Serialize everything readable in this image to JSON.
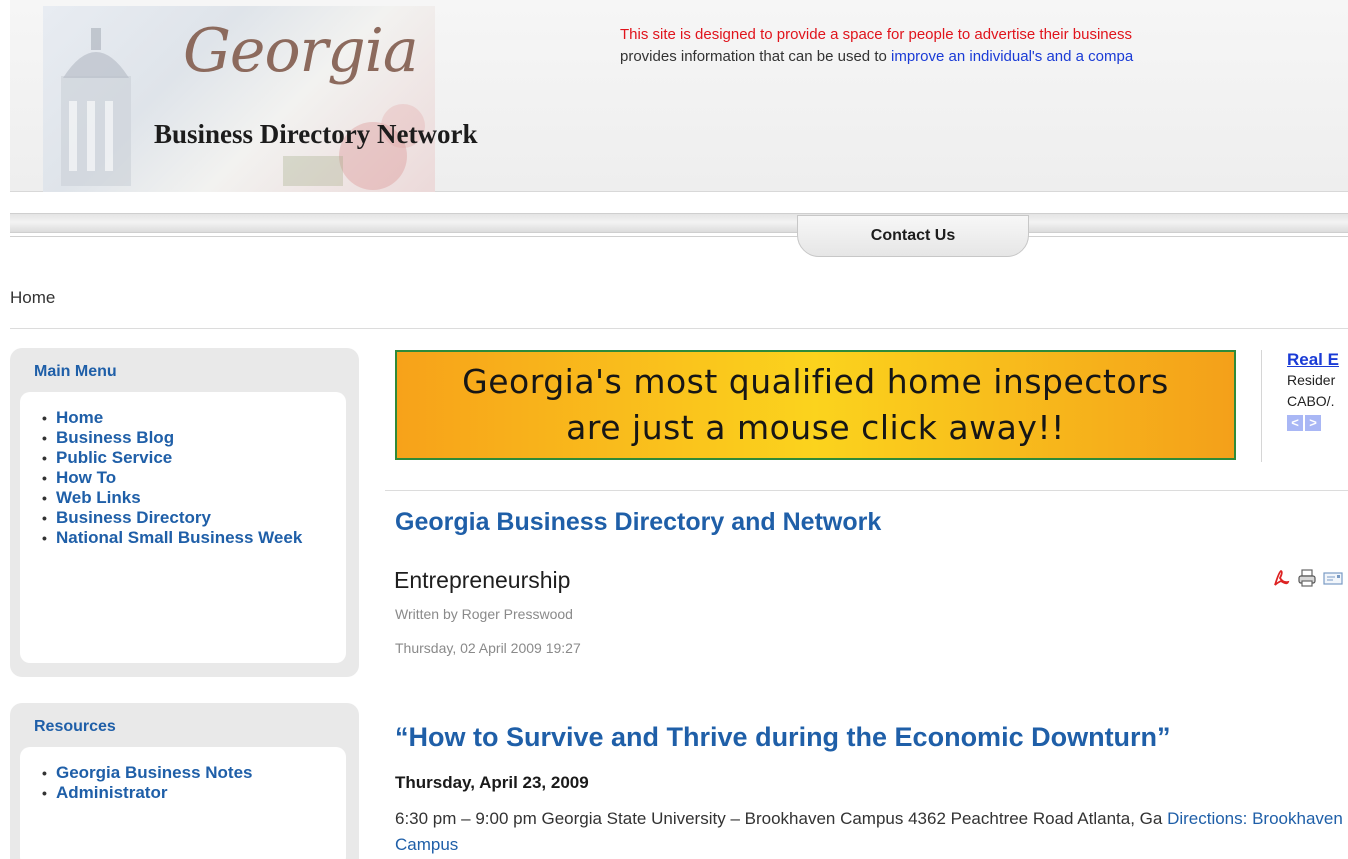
{
  "header": {
    "logo_script": "Georgia",
    "logo_tagline": "Business Directory Network",
    "blurb_line1": "This site is designed to provide a space for people to advertise their business",
    "blurb_line2_prefix": "provides information that can be used to ",
    "blurb_line2_link": "improve an individual's and a compa"
  },
  "nav": {
    "contact_label": "Contact Us"
  },
  "breadcrumb": {
    "label": "Home"
  },
  "main_menu": {
    "title": "Main Menu",
    "items": [
      "Home",
      "Business Blog",
      "Public Service",
      "How To",
      "Web Links",
      "Business Directory",
      "National Small Business Week"
    ]
  },
  "resources": {
    "title": "Resources",
    "items": [
      "Georgia Business Notes",
      "Administrator"
    ]
  },
  "banner": {
    "line1": "Georgia's most qualified home inspectors",
    "line2": "are just a mouse click away!!"
  },
  "side_ad": {
    "title": "Real E",
    "line1": "Resider",
    "line2": "CABO/."
  },
  "content": {
    "section_heading": "Georgia Business Directory and Network",
    "article_title": "Entrepreneurship",
    "author": "Written by Roger Presswood",
    "date": "Thursday, 02 April 2009 19:27",
    "event_heading": "“How to Survive and Thrive during the Economic Downturn”",
    "event_date": "Thursday, April 23, 2009",
    "event_desc": "6:30 pm – 9:00 pm Georgia State University – Brookhaven Campus 4362 Peachtree Road Atlanta, Ga ",
    "event_link": "Directions: Brookhaven Campus"
  },
  "tools": [
    "pdf-icon",
    "print-icon",
    "email-icon"
  ],
  "colors": {
    "link_blue": "#1f5fa8",
    "blurb_red": "#e0141c",
    "banner_border": "#2f8a3a",
    "banner_orange": "#f7a21a",
    "banner_yellow": "#fbd31d"
  }
}
